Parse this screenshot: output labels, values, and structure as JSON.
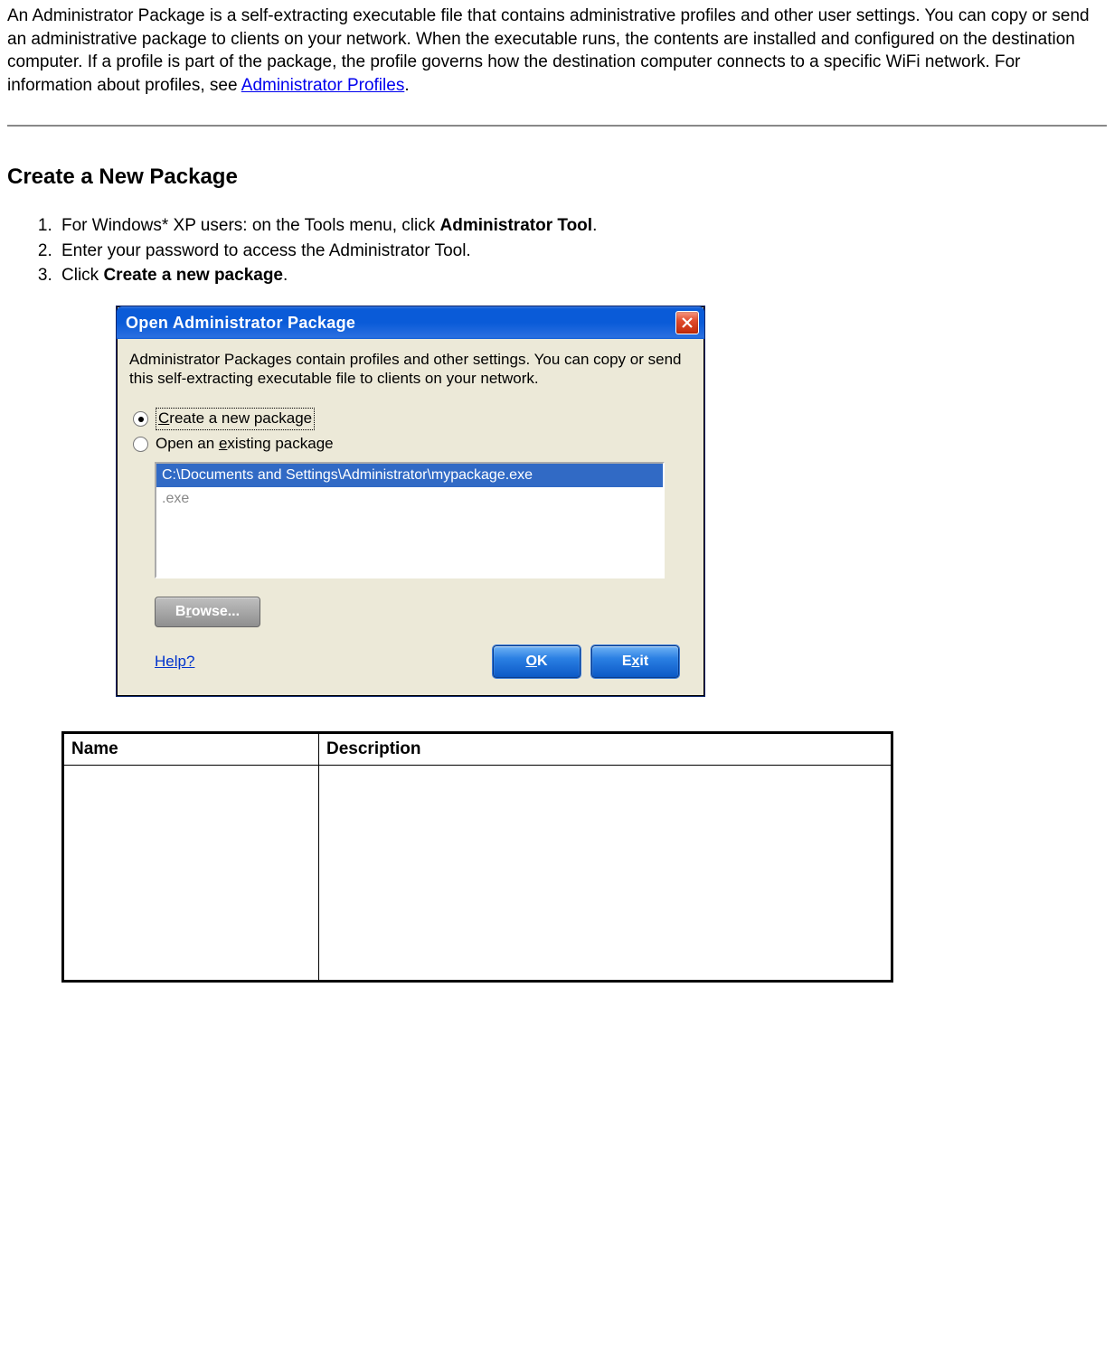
{
  "intro_text_1": "An Administrator Package is a self-extracting executable file that contains administrative profiles and other user settings. You can copy or send an administrative package to clients on your network. When the executable runs, the contents are installed and configured on the destination computer. If a profile is part of the package, the profile governs how the destination computer connects to a specific WiFi network. For information about profiles, see ",
  "intro_link": "Administrator Profiles",
  "intro_text_2": ".",
  "section_heading": "Create a New Package",
  "steps": {
    "s1_a": "For Windows* XP users: on the Tools menu, click ",
    "s1_b": "Administrator Tool",
    "s1_c": ".",
    "s2": "Enter your password to access the Administrator Tool.",
    "s3_a": "Click ",
    "s3_b": "Create a new package",
    "s3_c": "."
  },
  "dialog": {
    "title": "Open Administrator Package",
    "description": "Administrator Packages contain profiles and other settings. You can copy or send this self-extracting executable file to clients on your network.",
    "radio1_prefix": "C",
    "radio1_rest": "reate a new package",
    "radio2_pre": "Open an ",
    "radio2_key": "e",
    "radio2_post": "xisting package",
    "list_selected": "C:\\Documents and Settings\\Administrator\\mypackage.exe",
    "list_other": ".exe",
    "browse_pre": "B",
    "browse_key": "r",
    "browse_post": "owse...",
    "help": "Help?",
    "ok_key": "O",
    "ok_rest": "K",
    "exit_pre": "E",
    "exit_key": "x",
    "exit_post": "it"
  },
  "table": {
    "col1": "Name",
    "col2": "Description"
  }
}
